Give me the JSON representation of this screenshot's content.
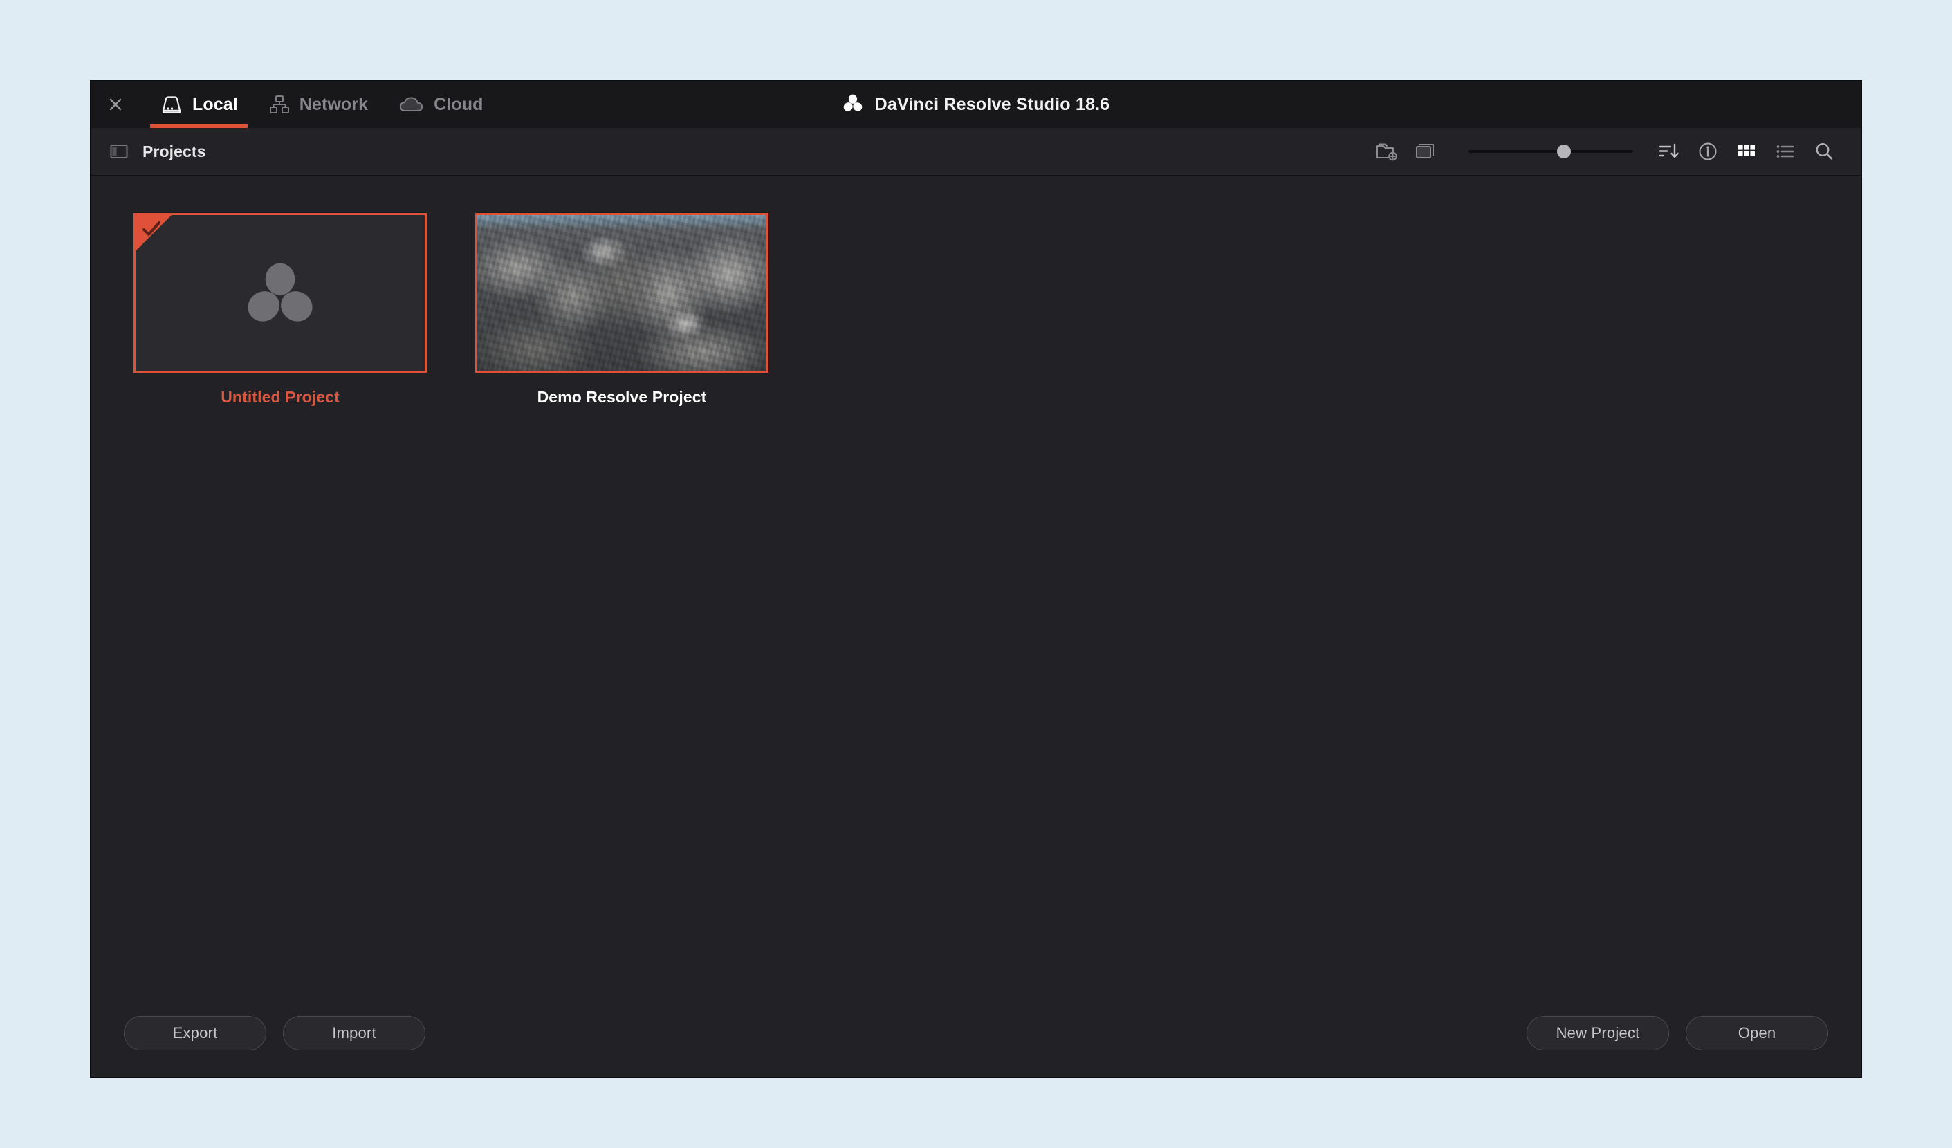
{
  "window": {
    "close_label": "×",
    "app_title": "DaVinci Resolve Studio 18.6",
    "logo_icon": "resolve-logo-icon"
  },
  "tabs": [
    {
      "label": "Local",
      "icon": "hard-drive-icon",
      "active": true
    },
    {
      "label": "Network",
      "icon": "network-nodes-icon",
      "active": false
    },
    {
      "label": "Cloud",
      "icon": "cloud-icon",
      "active": false
    }
  ],
  "toolbar": {
    "panel_toggle_icon": "sidebar-toggle-icon",
    "breadcrumb": "Projects",
    "new_folder_icon": "new-folder-icon",
    "project_library_icon": "project-library-icon",
    "zoom_slider": {
      "value": 58,
      "min": 0,
      "max": 100
    },
    "sort_icon": "sort-descending-icon",
    "info_icon": "info-circle-icon",
    "grid_view_icon": "grid-view-icon",
    "list_view_icon": "list-view-icon",
    "search_icon": "search-icon"
  },
  "projects": [
    {
      "name": "Untitled Project",
      "selected": true,
      "checked": true,
      "thumbnail": "resolve-logo-placeholder",
      "name_color": "#d9573f"
    },
    {
      "name": "Demo Resolve Project",
      "selected": true,
      "checked": false,
      "thumbnail": "photo-iguanas-on-rocks",
      "name_color": "#ffffff"
    }
  ],
  "footer": {
    "export_label": "Export",
    "import_label": "Import",
    "new_project_label": "New Project",
    "open_label": "Open"
  },
  "colors": {
    "accent": "#e0513a",
    "window_bg": "#222226",
    "header_bg": "#18181a",
    "toolbar_bg": "#232327",
    "page_bg": "#dfecf4"
  }
}
